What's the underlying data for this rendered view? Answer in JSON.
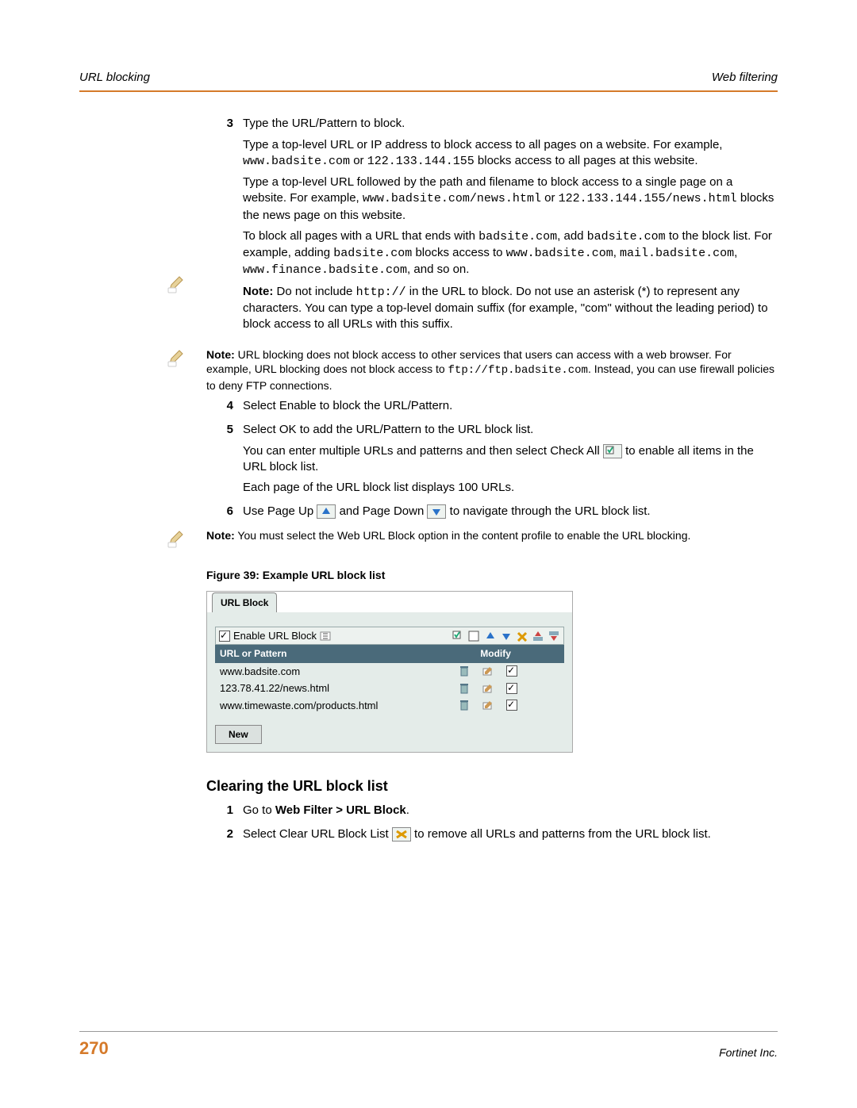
{
  "header": {
    "left": "URL blocking",
    "right": "Web filtering"
  },
  "steps": {
    "s3": {
      "num": "3",
      "l1": "Type the URL/Pattern to block.",
      "l2a": "Type a top-level URL or IP address to block access to all pages on a website. For example, ",
      "l2b": "www.badsite.com",
      "l2c": " or ",
      "l2d": "122.133.144.155",
      "l2e": " blocks access to all pages at this website.",
      "l3a": "Type a top-level URL followed by the path and filename to block access to a single page on a website. For example, ",
      "l3b": "www.badsite.com/news.html",
      "l3c": " or ",
      "l3d": "122.133.144.155/news.html",
      "l3e": " blocks the news page on this website.",
      "l4a": "To block all pages with a URL that ends with ",
      "l4b": "badsite.com",
      "l4c": ", add ",
      "l4d": "badsite.com",
      "l4e": " to the block list. For example, adding ",
      "l4f": "badsite.com",
      "l4g": " blocks access to ",
      "l4h": "www.badsite.com",
      "l4i": ", ",
      "l4j": "mail.badsite.com",
      "l4k": ", ",
      "l4l": "www.finance.badsite.com",
      "l4m": ", and so on.",
      "note1a": "Note:",
      "note1b": " Do not include ",
      "note1c": "http://",
      "note1d": " in the URL to block. Do not use an asterisk (*) to represent any characters. You can type a top-level domain suffix (for example, \"com\" without the leading period) to block access to all URLs with this suffix.",
      "note2a": "Note:",
      "note2b": " URL blocking does not block access to other services that users can access with a web browser. For example, URL blocking does not block access to ",
      "note2c": "ftp://ftp.badsite.com",
      "note2d": ". Instead, you can use firewall policies to deny FTP connections."
    },
    "s4": {
      "num": "4",
      "t": "Select Enable to block the URL/Pattern."
    },
    "s5": {
      "num": "5",
      "l1": "Select OK to add the URL/Pattern to the URL block list.",
      "l2a": "You can enter multiple URLs and patterns and then select Check All ",
      "l2b": " to enable all items in the URL block list.",
      "l3": "Each page of the URL block list displays 100 URLs."
    },
    "s6": {
      "num": "6",
      "a": "Use Page Up ",
      "b": " and Page Down ",
      "c": " to navigate through the URL block list.",
      "note_a": "Note:",
      "note_b": " You must select the Web URL Block option in the content profile to enable the URL blocking."
    }
  },
  "figure": {
    "caption": "Figure 39: Example URL block list",
    "tab": "URL Block",
    "enable_label": "Enable URL Block",
    "col1": "URL or Pattern",
    "col2": "Modify",
    "rows": [
      "www.badsite.com",
      "123.78.41.22/news.html",
      "www.timewaste.com/products.html"
    ],
    "new_btn": "New"
  },
  "section2": {
    "title": "Clearing the URL block list",
    "s1_num": "1",
    "s1_a": "Go to ",
    "s1_b": "Web Filter > URL Block",
    "s1_c": ".",
    "s2_num": "2",
    "s2_a": "Select Clear URL Block List ",
    "s2_b": " to remove all URLs and patterns from the URL block list."
  },
  "footer": {
    "page": "270",
    "right": "Fortinet Inc."
  }
}
